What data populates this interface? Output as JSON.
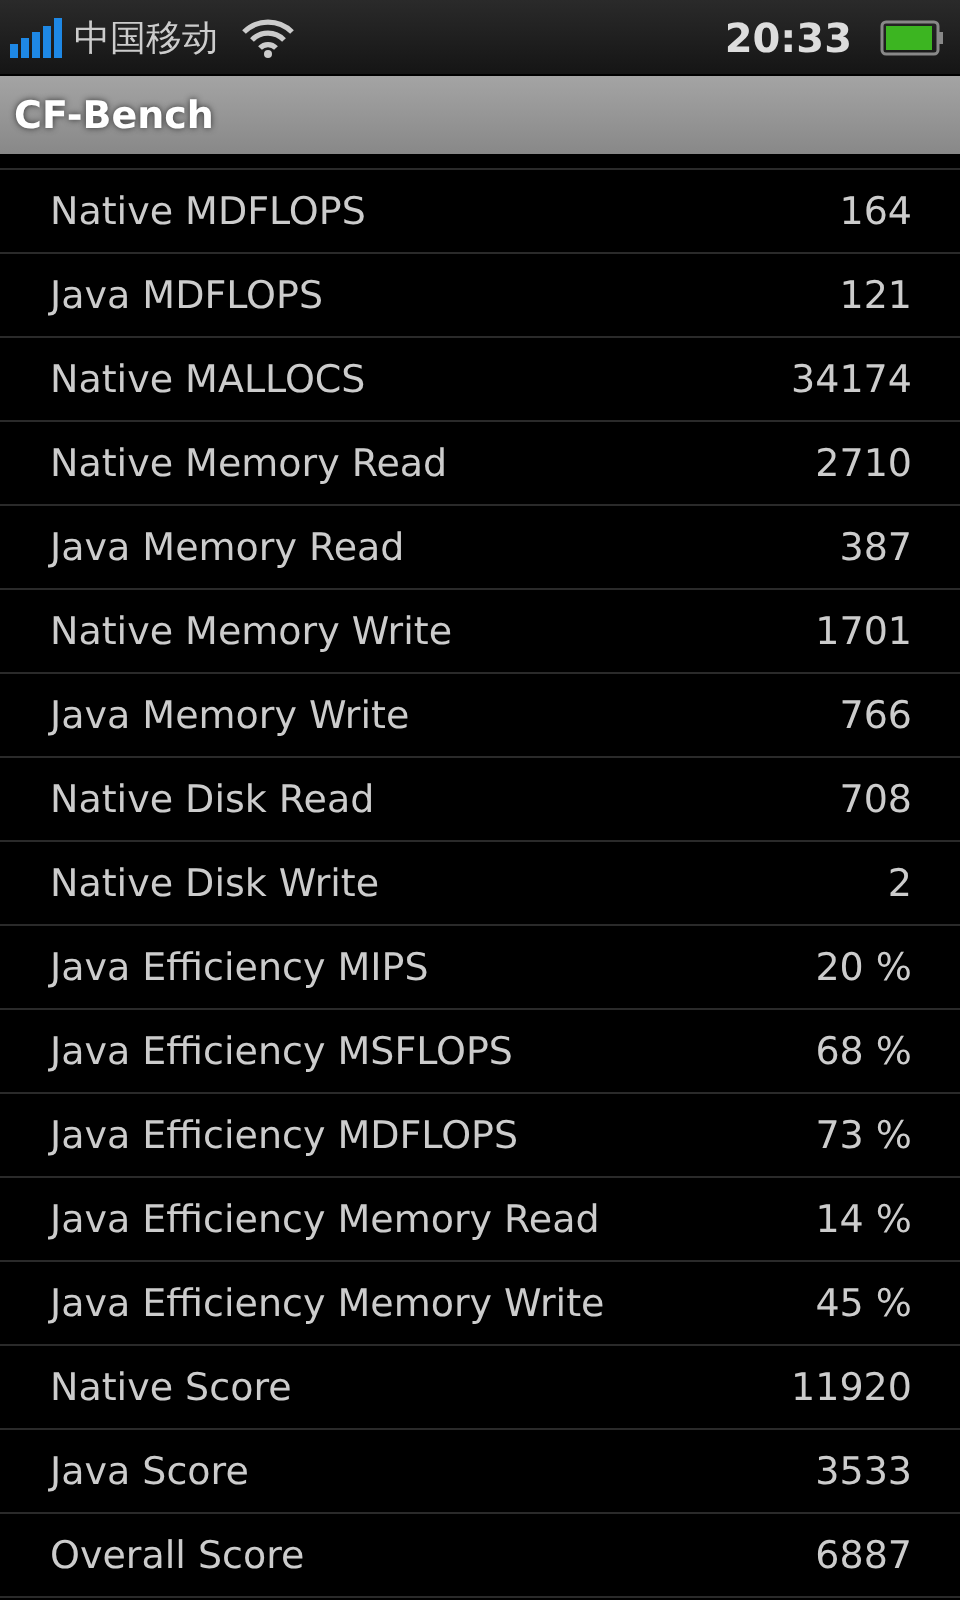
{
  "status_bar": {
    "carrier": "中国移动",
    "time": "20:33"
  },
  "title_bar": {
    "title": "CF-Bench"
  },
  "results": [
    {
      "name": "Native MDFLOPS",
      "value": "164"
    },
    {
      "name": "Java MDFLOPS",
      "value": "121"
    },
    {
      "name": "Native MALLOCS",
      "value": "34174"
    },
    {
      "name": "Native Memory Read",
      "value": "2710"
    },
    {
      "name": "Java Memory Read",
      "value": "387"
    },
    {
      "name": "Native Memory Write",
      "value": "1701"
    },
    {
      "name": "Java Memory Write",
      "value": "766"
    },
    {
      "name": "Native Disk Read",
      "value": "708"
    },
    {
      "name": "Native Disk Write",
      "value": "2"
    },
    {
      "name": "Java Efficiency MIPS",
      "value": "20 %"
    },
    {
      "name": "Java Efficiency MSFLOPS",
      "value": "68 %"
    },
    {
      "name": "Java Efficiency MDFLOPS",
      "value": "73 %"
    },
    {
      "name": "Java Efficiency Memory Read",
      "value": "14 %"
    },
    {
      "name": "Java Efficiency Memory Write",
      "value": "45 %"
    },
    {
      "name": "Native Score",
      "value": "11920"
    },
    {
      "name": "Java Score",
      "value": "3533"
    },
    {
      "name": "Overall Score",
      "value": "6887"
    }
  ]
}
